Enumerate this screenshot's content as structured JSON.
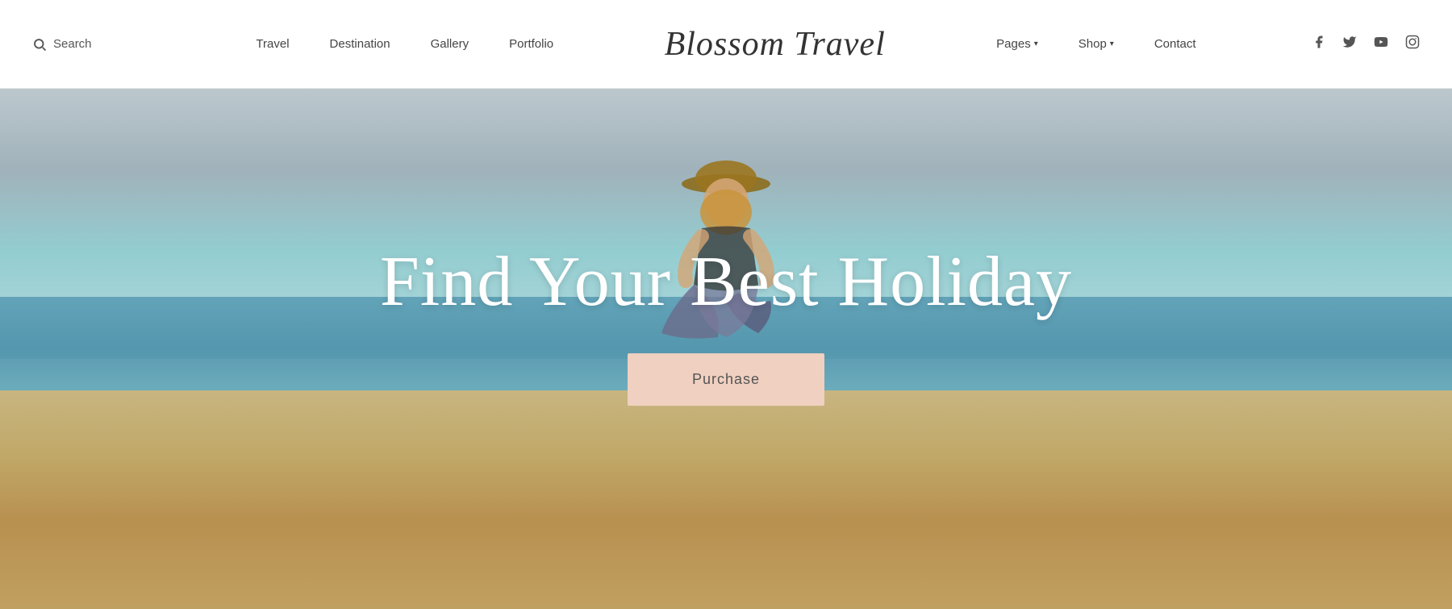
{
  "header": {
    "search_label": "Search",
    "logo_text": "Blossom Travel",
    "nav": {
      "travel": "Travel",
      "destination": "Destination",
      "gallery": "Gallery",
      "portfolio": "Portfolio",
      "pages": "Pages",
      "shop": "Shop",
      "contact": "Contact"
    },
    "social": {
      "facebook": "f",
      "twitter": "𝕏",
      "youtube": "▶",
      "instagram": "◻"
    }
  },
  "hero": {
    "title": "Find Your Best Holiday",
    "purchase_label": "Purchase"
  }
}
